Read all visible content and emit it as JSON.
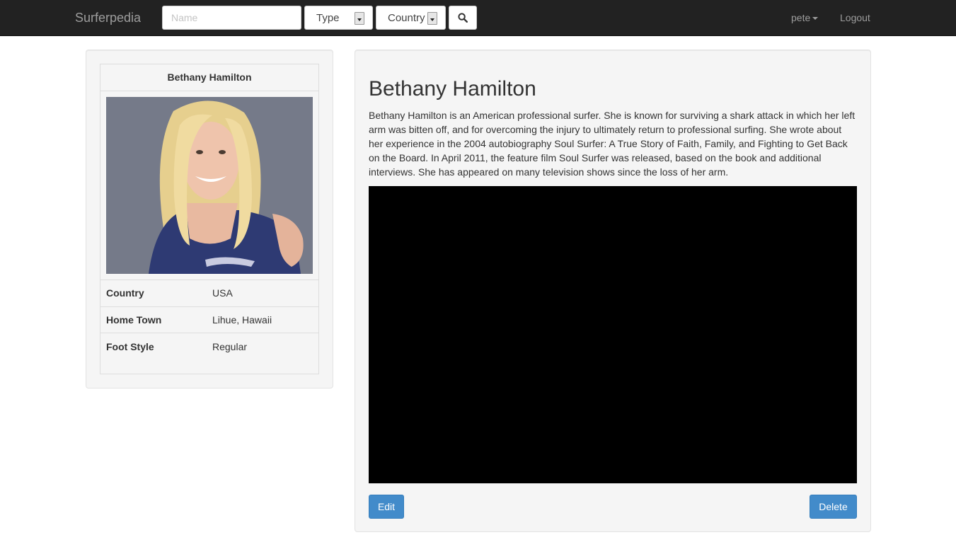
{
  "navbar": {
    "brand": "Surferpedia",
    "name_placeholder": "Name",
    "type_select": "Type",
    "country_select": "Country",
    "search_icon": "search-icon",
    "user": "pete",
    "logout": "Logout"
  },
  "profile": {
    "name": "Bethany Hamilton",
    "details": [
      {
        "label": "Country",
        "value": "USA"
      },
      {
        "label": "Home Town",
        "value": "Lihue, Hawaii"
      },
      {
        "label": "Foot Style",
        "value": "Regular"
      }
    ]
  },
  "main": {
    "title": "Bethany Hamilton",
    "bio": "Bethany Hamilton is an American professional surfer. She is known for surviving a shark attack in which her left arm was bitten off, and for overcoming the injury to ultimately return to professional surfing. She wrote about her experience in the 2004 autobiography Soul Surfer: A True Story of Faith, Family, and Fighting to Get Back on the Board. In April 2011, the feature film Soul Surfer was released, based on the book and additional interviews. She has appeared on many television shows since the loss of her arm.",
    "edit_label": "Edit",
    "delete_label": "Delete"
  },
  "colors": {
    "navbar_bg": "#222222",
    "primary": "#428bca"
  }
}
